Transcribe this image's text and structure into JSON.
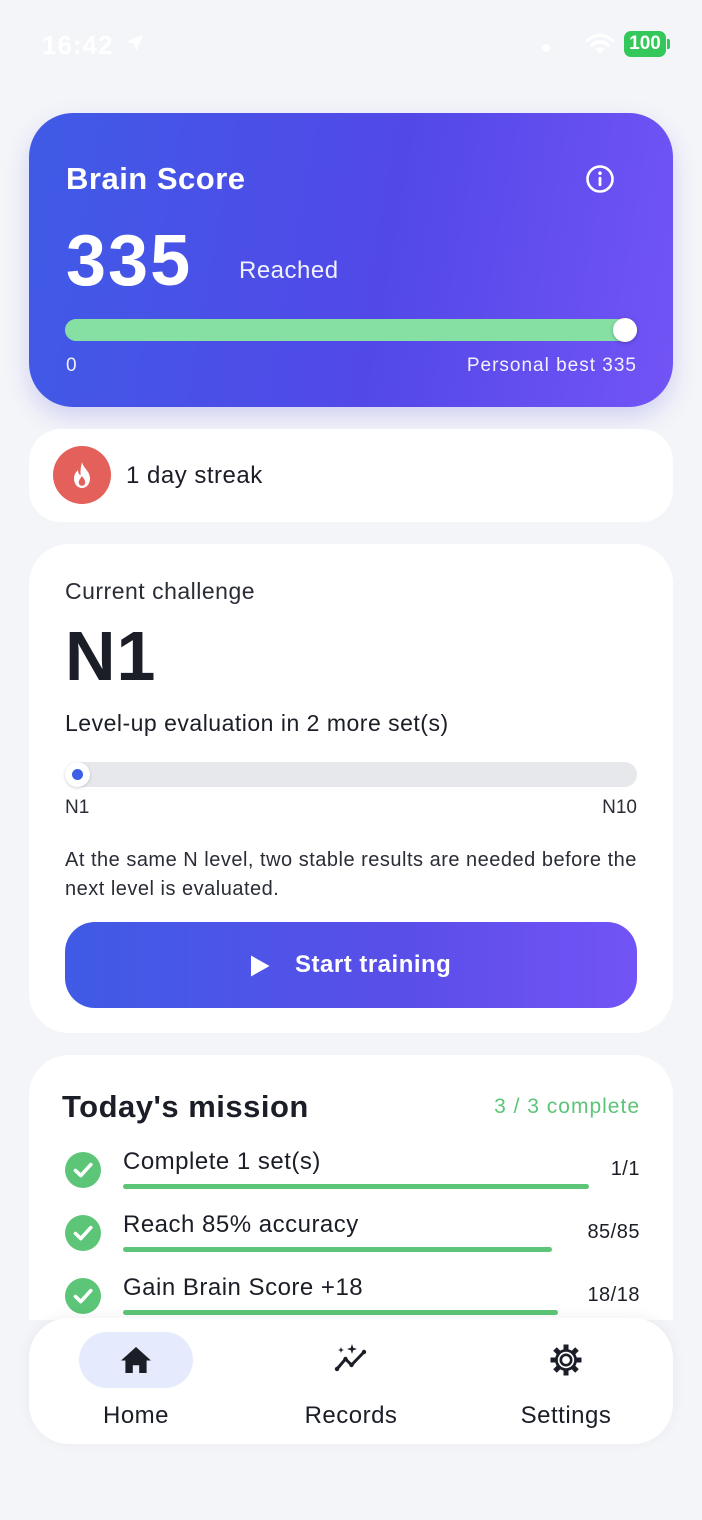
{
  "status_bar": {
    "time": "16:42",
    "battery": "100"
  },
  "brain_score": {
    "title": "Brain Score",
    "score": "335",
    "status": "Reached",
    "range_min": "0",
    "personal_best": "Personal best 335",
    "progress_percent": 100
  },
  "streak": {
    "text": "1 day streak"
  },
  "challenge": {
    "label": "Current challenge",
    "level": "N1",
    "evaluation": "Level-up evaluation in 2 more set(s)",
    "level_min": "N1",
    "level_max": "N10",
    "current_level_index": 1,
    "description": "At the same N level, two stable results are needed before the next level is evaluated.",
    "start_label": "Start training"
  },
  "mission": {
    "title": "Today's mission",
    "progress": "3 / 3 complete",
    "items": [
      {
        "label": "Complete 1 set(s)",
        "value": "1/1"
      },
      {
        "label": "Reach 85% accuracy",
        "value": "85/85"
      },
      {
        "label": "Gain Brain Score +18",
        "value": "18/18"
      }
    ]
  },
  "nav": {
    "items": [
      {
        "label": "Home",
        "icon": "home-icon",
        "active": true
      },
      {
        "label": "Records",
        "icon": "trend-sparkle-icon",
        "active": false
      },
      {
        "label": "Settings",
        "icon": "gear-icon",
        "active": false
      }
    ]
  },
  "colors": {
    "accent_blue": "#3f5be6",
    "accent_purple": "#7354f6",
    "success_green": "#5cc577",
    "streak_red": "#e4605a"
  }
}
